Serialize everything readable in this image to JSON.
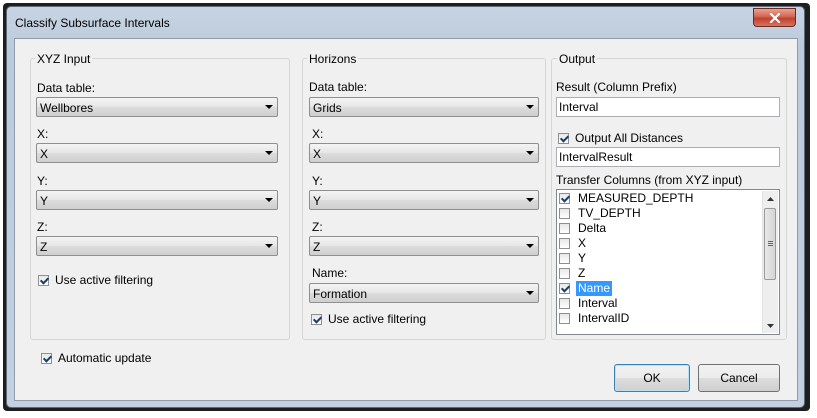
{
  "window": {
    "title": "Classify Subsurface Intervals"
  },
  "xyz_input": {
    "group_title": "XYZ Input",
    "data_table_label": "Data table:",
    "data_table_value": "Wellbores",
    "x_label": "X:",
    "x_value": "X",
    "y_label": "Y:",
    "y_value": "Y",
    "z_label": "Z:",
    "z_value": "Z",
    "active_filtering_label": "Use active filtering",
    "active_filtering_checked": true
  },
  "horizons": {
    "group_title": "Horizons",
    "data_table_label": "Data table:",
    "data_table_value": "Grids",
    "x_label": "X:",
    "x_value": "X",
    "y_label": "Y:",
    "y_value": "Y",
    "z_label": "Z:",
    "z_value": "Z",
    "name_label": "Name:",
    "name_value": "Formation",
    "active_filtering_label": "Use active filtering",
    "active_filtering_checked": true
  },
  "output": {
    "group_title": "Output",
    "result_label": "Result (Column Prefix)",
    "result_value": "Interval",
    "all_distances_label": "Output All Distances",
    "all_distances_checked": true,
    "distances_value": "IntervalResult",
    "transfer_label": "Transfer Columns (from XYZ input)",
    "transfer_columns": [
      {
        "label": "MEASURED_DEPTH",
        "checked": true,
        "selected": false
      },
      {
        "label": "TV_DEPTH",
        "checked": false,
        "selected": false
      },
      {
        "label": "Delta",
        "checked": false,
        "selected": false
      },
      {
        "label": "X",
        "checked": false,
        "selected": false
      },
      {
        "label": "Y",
        "checked": false,
        "selected": false
      },
      {
        "label": "Z",
        "checked": false,
        "selected": false
      },
      {
        "label": "Name",
        "checked": true,
        "selected": true
      },
      {
        "label": "Interval",
        "checked": false,
        "selected": false
      },
      {
        "label": "IntervalID",
        "checked": false,
        "selected": false
      }
    ]
  },
  "automatic_update": {
    "label": "Automatic update",
    "checked": true
  },
  "buttons": {
    "ok": "OK",
    "cancel": "Cancel"
  },
  "colors": {
    "selection": "#3399ff",
    "dialog_bg": "#f0f0f0",
    "title_glass": "#c2d0e0",
    "close_red": "#c0402a"
  }
}
